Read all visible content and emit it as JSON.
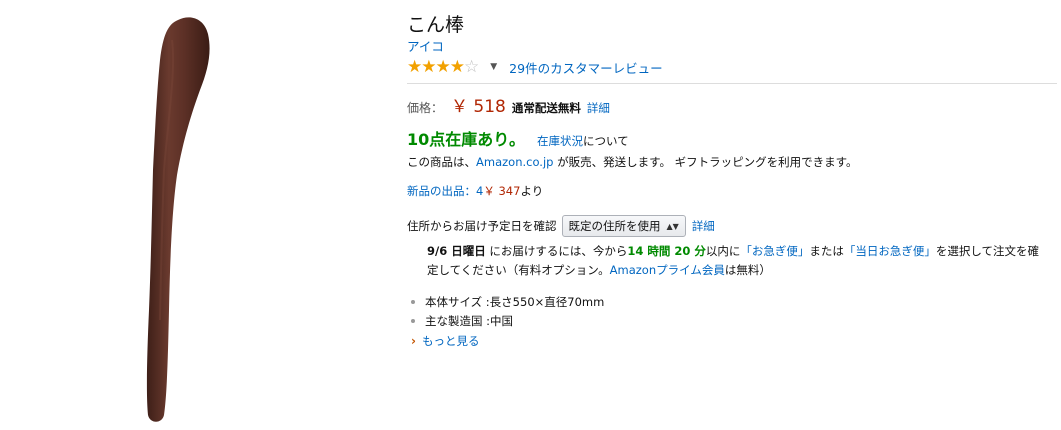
{
  "product": {
    "title": "こん棒",
    "brand": "アイコ",
    "rating": 4.0,
    "rating_max": 5,
    "reviews_label": "29件のカスタマーレビュー"
  },
  "price": {
    "label": "価格：",
    "value": "￥ 518",
    "shipping": "通常配送無料",
    "detail_link": "詳細"
  },
  "stock": {
    "text": "10点在庫あり。",
    "status_link": "在庫状況",
    "status_suffix": "について"
  },
  "seller": {
    "prefix": "この商品は、",
    "link": "Amazon.co.jp",
    "suffix": " が販売、発送します。 ギフトラッピングを利用できます。"
  },
  "new_offers": {
    "label": "新品の出品：4",
    "price": "￥ 347",
    "suffix": "より"
  },
  "delivery": {
    "label": "住所からお届け予定日を確認",
    "select_value": "既定の住所を使用",
    "detail_link": "詳細",
    "date": "9/6 日曜日",
    "msg1": " にお届けするには、今から",
    "countdown": "14 時間 20 分",
    "msg2": "以内に",
    "option1": "「お急ぎ便」",
    "msg3": "または",
    "option2": "「当日お急ぎ便」",
    "msg4": "を選択して注文を確定してください（有料オプション。",
    "prime_link": "Amazonプライム会員",
    "msg5": "は無料）"
  },
  "specs": [
    "本体サイズ :長さ550×直径70mm",
    "主な製造国 :中国"
  ],
  "more_link": "もっと見る",
  "colors": {
    "link": "#0066c0",
    "price": "#b12704",
    "stock": "#008a00",
    "star": "#f2a100",
    "club": "#5a2e24"
  }
}
